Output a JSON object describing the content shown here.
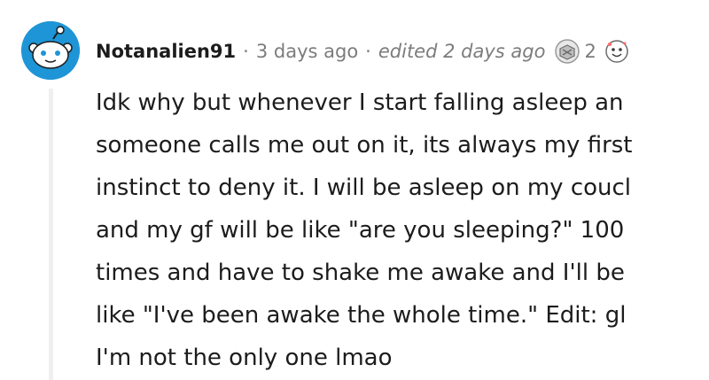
{
  "comment": {
    "author": "Notanalien91",
    "time": "3 days ago",
    "edited": "edited 2 days ago",
    "award_count": "2",
    "body_lines": [
      "Idk why but whenever I start falling asleep an",
      "someone calls me out on it, its always my first",
      "instinct to deny it. I will be asleep on my coucl",
      "and my gf will be like \"are you sleeping?\" 100",
      "times and have to shake me awake and I'll be",
      "like \"I've been awake the whole time.\" Edit: gl",
      "I'm not the only one lmao"
    ]
  },
  "colors": {
    "avatar_bg": "#1e95d6",
    "meta_text": "#7c7c7c",
    "thread_line": "#edeff1"
  },
  "icons": {
    "avatar": "snoo-alien-avatar-icon",
    "award_1": "helpful-hug-award-icon",
    "award_2": "wholesome-face-award-icon"
  }
}
